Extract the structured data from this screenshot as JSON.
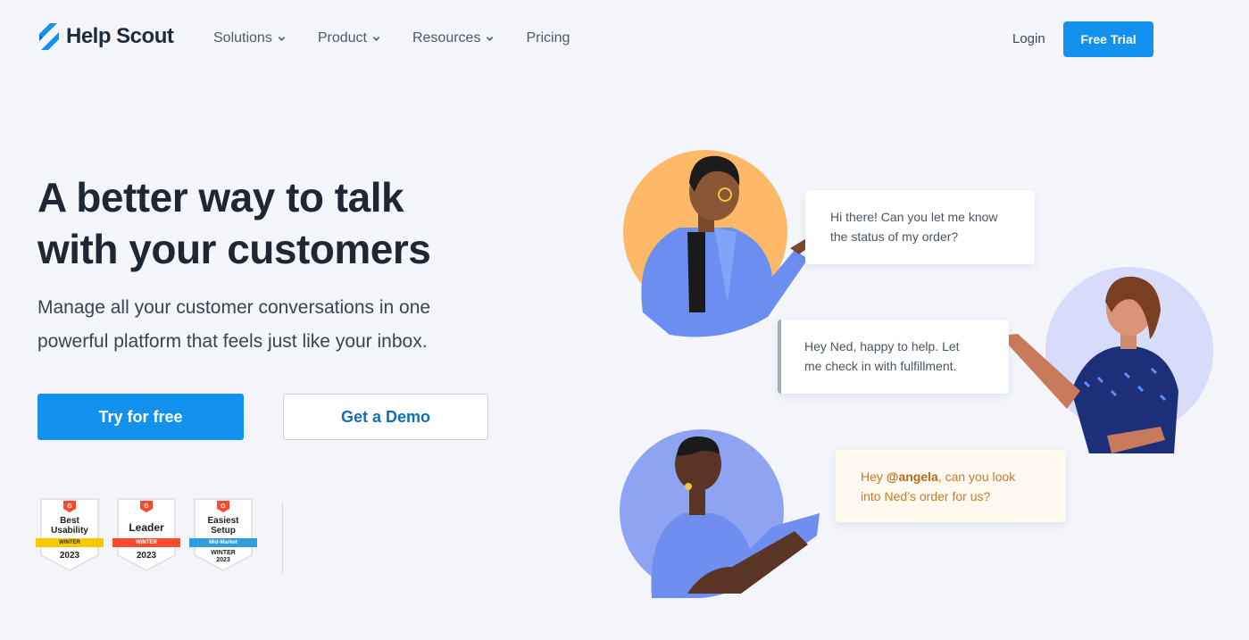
{
  "brand": {
    "name": "Help Scout",
    "color": "#1292ee"
  },
  "nav": {
    "items": [
      {
        "label": "Solutions",
        "has_dropdown": true
      },
      {
        "label": "Product",
        "has_dropdown": true
      },
      {
        "label": "Resources",
        "has_dropdown": true
      },
      {
        "label": "Pricing",
        "has_dropdown": false
      }
    ],
    "login": "Login",
    "cta": "Free Trial"
  },
  "hero": {
    "title_line1": "A better way to talk",
    "title_line2": "with your customers",
    "subtitle_line1": "Manage all your customer conversations in one",
    "subtitle_line2": "powerful platform that feels just like your inbox.",
    "primary_cta": "Try for free",
    "secondary_cta": "Get a Demo"
  },
  "badges": [
    {
      "title": "Best Usability",
      "title_l1": "Best",
      "title_l2": "Usability",
      "ribbon": "WINTER",
      "ribbon_color": "#f7c800",
      "year": "2023"
    },
    {
      "title": "Leader",
      "ribbon": "WINTER",
      "ribbon_color": "#ff492c",
      "year": "2023"
    },
    {
      "title": "Easiest Setup",
      "title_l1": "Easiest",
      "title_l2": "Setup",
      "ribbon": "Mid-Market",
      "ribbon_color": "#2e9ee0",
      "sub": "WINTER",
      "year": "2023"
    }
  ],
  "conversation": [
    {
      "line1": "Hi there! Can you let me know",
      "line2": "the status of my order?"
    },
    {
      "line1": "Hey Ned, happy to help. Let",
      "line2": "me check in with fulfillment."
    },
    {
      "prefix": "Hey ",
      "mention": "@angela",
      "line1_rest": ", can you look",
      "line2": "into Ned’s order for us?"
    }
  ]
}
